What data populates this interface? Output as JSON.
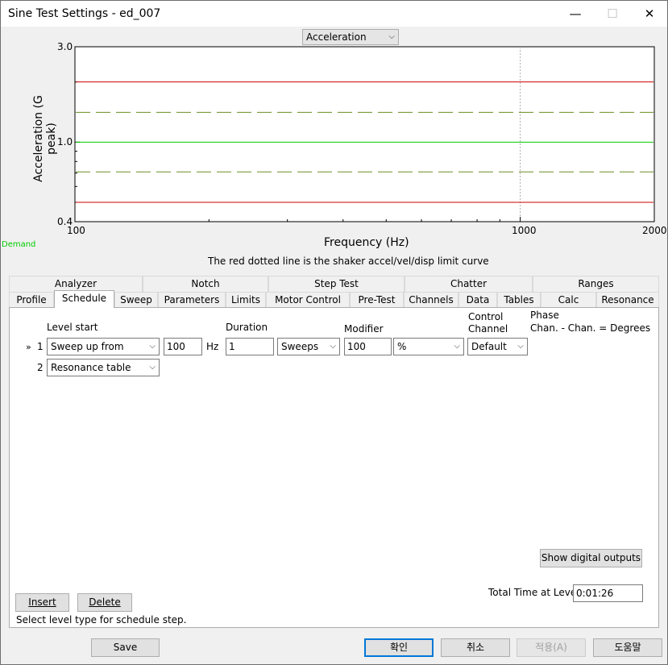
{
  "window": {
    "title": "Sine Test Settings - ed_007",
    "minimize": "—",
    "maximize": "☐",
    "close": "✕"
  },
  "plot": {
    "selector": "Acceleration",
    "demand_label": "Demand",
    "note": "The red dotted line is the shaker accel/vel/disp limit curve"
  },
  "chart_data": {
    "type": "line",
    "xlabel": "Frequency (Hz)",
    "ylabel": "Acceleration (G peak)",
    "xscale": "log",
    "yscale": "log",
    "xlim": [
      100,
      2000
    ],
    "ylim": [
      0.4,
      3.0
    ],
    "x_ticks": [
      "100",
      "1000",
      "2000"
    ],
    "y_ticks": [
      "0.4",
      "1.0",
      "3.0"
    ],
    "grid": "vertical dotted at 1000",
    "series": [
      {
        "style": "solid",
        "color": "#cc0000",
        "x": [
          100,
          2000
        ],
        "y": [
          2.0,
          2.0
        ]
      },
      {
        "style": "dashed",
        "color": "#6b8e23",
        "x": [
          100,
          2000
        ],
        "y": [
          1.41,
          1.41
        ]
      },
      {
        "style": "solid",
        "color": "#00cc00",
        "x": [
          100,
          2000
        ],
        "y": [
          1.0,
          1.0
        ]
      },
      {
        "style": "dashed",
        "color": "#6b8e23",
        "x": [
          100,
          2000
        ],
        "y": [
          0.71,
          0.71
        ]
      },
      {
        "style": "solid",
        "color": "#cc0000",
        "x": [
          100,
          2000
        ],
        "y": [
          0.5,
          0.5
        ]
      }
    ]
  },
  "tabs": {
    "row1": [
      "Analyzer",
      "Notch",
      "Step Test",
      "Chatter",
      "Ranges"
    ],
    "row2": [
      "Profile",
      "Schedule",
      "Sweep",
      "Parameters",
      "Limits",
      "Motor Control",
      "Pre-Test",
      "Channels",
      "Data",
      "Tables",
      "Calc",
      "Resonance"
    ],
    "selected": "Schedule"
  },
  "schedule": {
    "headers": {
      "level_start": "Level start",
      "duration": "Duration",
      "modifier": "Modifier",
      "control_channel": "Control\nChannel",
      "phase": "Phase",
      "phase_sub": "Chan. - Chan. = Degrees"
    },
    "rows": [
      {
        "marker": "»",
        "num": "1",
        "type": "Sweep up from",
        "freq": "100",
        "unit": "Hz",
        "duration": "1",
        "duration_unit": "Sweeps",
        "modifier": "100",
        "modifier_unit": "%",
        "control": "Default"
      },
      {
        "marker": "",
        "num": "2",
        "type": "Resonance table"
      }
    ],
    "show_digital_outputs": "Show digital outputs",
    "total_time_label": "Total Time at Level",
    "total_time": "0:01:26",
    "insert": "Insert",
    "delete": "Delete",
    "status": "Select level type for schedule step."
  },
  "footer": {
    "save": "Save",
    "ok": "확인",
    "cancel": "취소",
    "apply": "적용(A)",
    "help": "도움말"
  }
}
